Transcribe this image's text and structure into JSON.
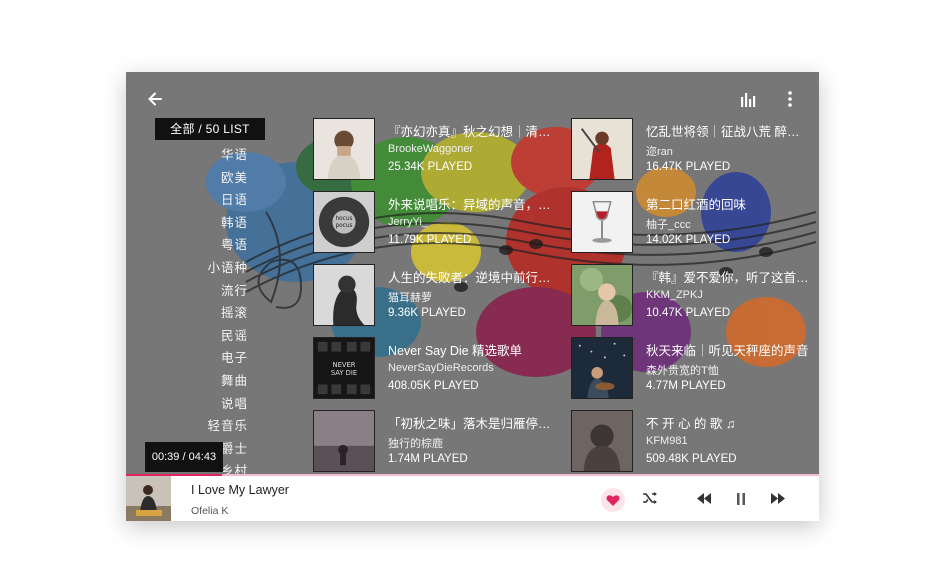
{
  "header": {
    "back_icon": "arrow-left-icon",
    "equalizer_icon": "equalizer-icon",
    "more_icon": "more-vertical-icon"
  },
  "categories": {
    "selected_label": "全部 / 50 LIST",
    "items": [
      "华语",
      "欧美",
      "日语",
      "韩语",
      "粤语",
      "小语种",
      "流行",
      "摇滚",
      "民谣",
      "电子",
      "舞曲",
      "说唱",
      "轻音乐",
      "爵士",
      "乡村"
    ]
  },
  "time_display": "00:39 / 04:43",
  "playlists": [
    {
      "title": "『亦幻亦真』秋之幻想｜清新空灵",
      "user": "BrookeWaggoner",
      "plays": "25.34K PLAYED"
    },
    {
      "title": "外来说唱乐：异域的声音，不同的故事",
      "user": "JerryYi_",
      "plays": "11.79K PLAYED"
    },
    {
      "title": "人生的失败者：逆境中前行的歌",
      "user": "猫耳赫萝",
      "plays": "9.36K PLAYED"
    },
    {
      "title": "Never Say Die 精选歌单",
      "user": "NeverSayDieRecords",
      "plays": "408.05K PLAYED"
    },
    {
      "title": "「初秋之味」落木是归雁停留的地方",
      "user": "独行的棕鹿",
      "plays": "1.74M PLAYED"
    },
    {
      "title": "忆乱世将领｜征战八荒 醉卧沙场",
      "user": "迩ran",
      "plays": "16.47K PLAYED"
    },
    {
      "title": "第二口红酒的回味",
      "user": "柚子_ccc",
      "plays": "14.02K PLAYED"
    },
    {
      "title": "『韩』爱不爱你，听了这首歌就知道",
      "user": "KKM_ZPKJ",
      "plays": "10.47K PLAYED"
    },
    {
      "title": "秋天来临｜听见天秤座的声音",
      "user": "森外贵宽的T恤",
      "plays": "4.77M PLAYED"
    },
    {
      "title": "不 开 心 的 歌 ♫",
      "user": "KFM981",
      "plays": "509.48K PLAYED"
    }
  ],
  "covers": {
    "never_say_die_text": [
      "NEVER",
      "SAY DIE"
    ],
    "hocus_text": [
      "hocus",
      "pocus"
    ]
  },
  "now_playing": {
    "title": "I Love My Lawyer",
    "artist": "Ofelia K",
    "progress": 0.138,
    "liked": true
  },
  "controls": {
    "like_icon": "heart-icon",
    "shuffle_icon": "shuffle-icon",
    "prev_icon": "previous-icon",
    "pause_icon": "pause-icon",
    "next_icon": "next-icon"
  },
  "colors": {
    "accent": "#e0245e",
    "overlay": "#7a7a7a"
  }
}
